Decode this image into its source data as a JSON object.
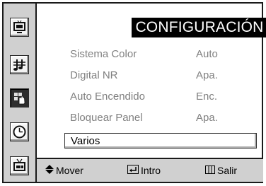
{
  "menu": {
    "title": "CONFIGURACIÓN",
    "items": [
      {
        "label": "Sistema Color",
        "value": "Auto"
      },
      {
        "label": "Digital NR",
        "value": "Apa."
      },
      {
        "label": "Auto Encendido",
        "value": "Enc."
      },
      {
        "label": "Bloquear Panel",
        "value": "Apa."
      }
    ],
    "selected_item": {
      "label": "Varios"
    }
  },
  "sidebar": {
    "icons": [
      "tv-picture-icon",
      "sound-note-icon",
      "setup-hand-icon",
      "clock-icon",
      "channel-tv-icon"
    ],
    "active": "setup-hand-icon"
  },
  "footer": {
    "move_label": "Mover",
    "move_icon": "updown-arrow-icon",
    "enter_label": "Intro",
    "enter_icon": "enter-icon",
    "exit_label": "Salir",
    "exit_icon": "menu-exit-icon"
  },
  "colors": {
    "title_bg": "#000000",
    "title_fg": "#ffffff",
    "disabled_text": "#808080",
    "panel": "#d0d0d0"
  }
}
